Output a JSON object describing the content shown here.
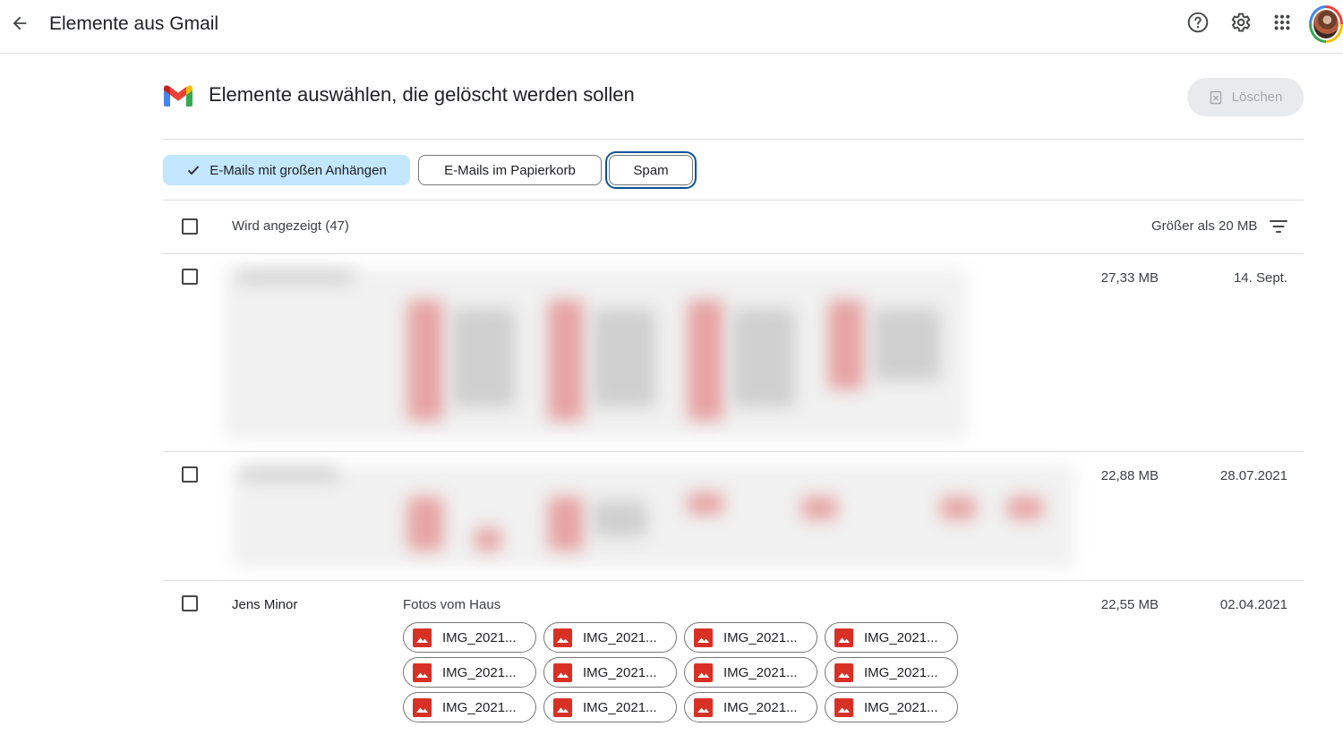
{
  "topbar": {
    "title": "Elemente aus Gmail",
    "back_icon": "arrow-back-icon",
    "help_icon": "help-icon",
    "settings_icon": "gear-icon",
    "apps_icon": "apps-grid-icon"
  },
  "header": {
    "title": "Elemente auswählen, die gelöscht werden sollen",
    "delete_label": "Löschen"
  },
  "chips": {
    "large_attachments": "E-Mails mit großen Anhängen",
    "trash": "E-Mails im Papierkorb",
    "spam": "Spam"
  },
  "list": {
    "showing_label": "Wird angezeigt (47)",
    "filter_label": "Größer als 20 MB",
    "rows": [
      {
        "size": "27,33 MB",
        "date": "14. Sept."
      },
      {
        "size": "22,88 MB",
        "date": "28.07.2021"
      },
      {
        "sender": "Jens Minor",
        "subject": "Fotos vom Haus",
        "size": "22,55 MB",
        "date": "02.04.2021",
        "attachments": [
          "IMG_2021...",
          "IMG_2021...",
          "IMG_2021...",
          "IMG_2021...",
          "IMG_2021...",
          "IMG_2021...",
          "IMG_2021...",
          "IMG_2021...",
          "IMG_2021...",
          "IMG_2021...",
          "IMG_2021...",
          "IMG_2021..."
        ]
      }
    ]
  },
  "colors": {
    "selected_chip": "#c2e7ff",
    "focus_outline": "#0b5394",
    "image_icon": "#d93025"
  }
}
